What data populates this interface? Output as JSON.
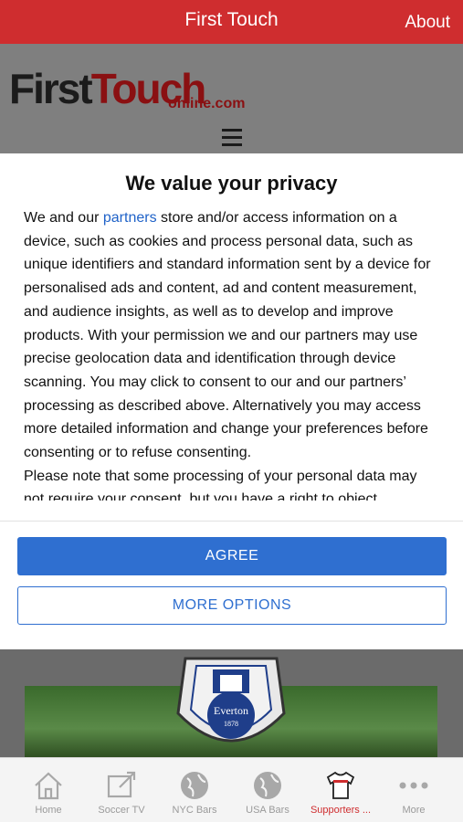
{
  "topbar": {
    "title": "First Touch",
    "about": "About"
  },
  "site": {
    "logo_first": "First",
    "logo_touch": "Touch",
    "logo_online": "online.com"
  },
  "dialog": {
    "heading": "We value your privacy",
    "p1_before_link": "We and our ",
    "p1_link": "partners",
    "p1_after_link": " store and/or access information on a device, such as cookies and process personal data, such as unique identifiers and standard information sent by a device for personalised ads and content, ad and content measurement, and audience insights, as well as to develop and improve products. With your permission we and our partners may use precise geolocation data and identification through device scanning. You may click to consent to our and our partners’ processing as described above. Alternatively you may access more detailed information and change your preferences before consenting or to refuse consenting.",
    "p2": "Please note that some processing of your personal data may not require your consent, but you have a right to object",
    "agree": "AGREE",
    "more_options": "MORE OPTIONS"
  },
  "hero": {
    "crest_name": "Everton",
    "crest_year": "1878"
  },
  "tabs": [
    {
      "label": "Home",
      "icon": "home-icon"
    },
    {
      "label": "Soccer TV",
      "icon": "tv-icon"
    },
    {
      "label": "NYC Bars",
      "icon": "globe-icon"
    },
    {
      "label": "USA Bars",
      "icon": "globe-icon"
    },
    {
      "label": "Supporters ...",
      "icon": "jersey-icon",
      "active": true
    },
    {
      "label": "More",
      "icon": "more-icon"
    }
  ],
  "colors": {
    "brand_red": "#cf2d2f",
    "accent_blue": "#2f6fd0"
  }
}
